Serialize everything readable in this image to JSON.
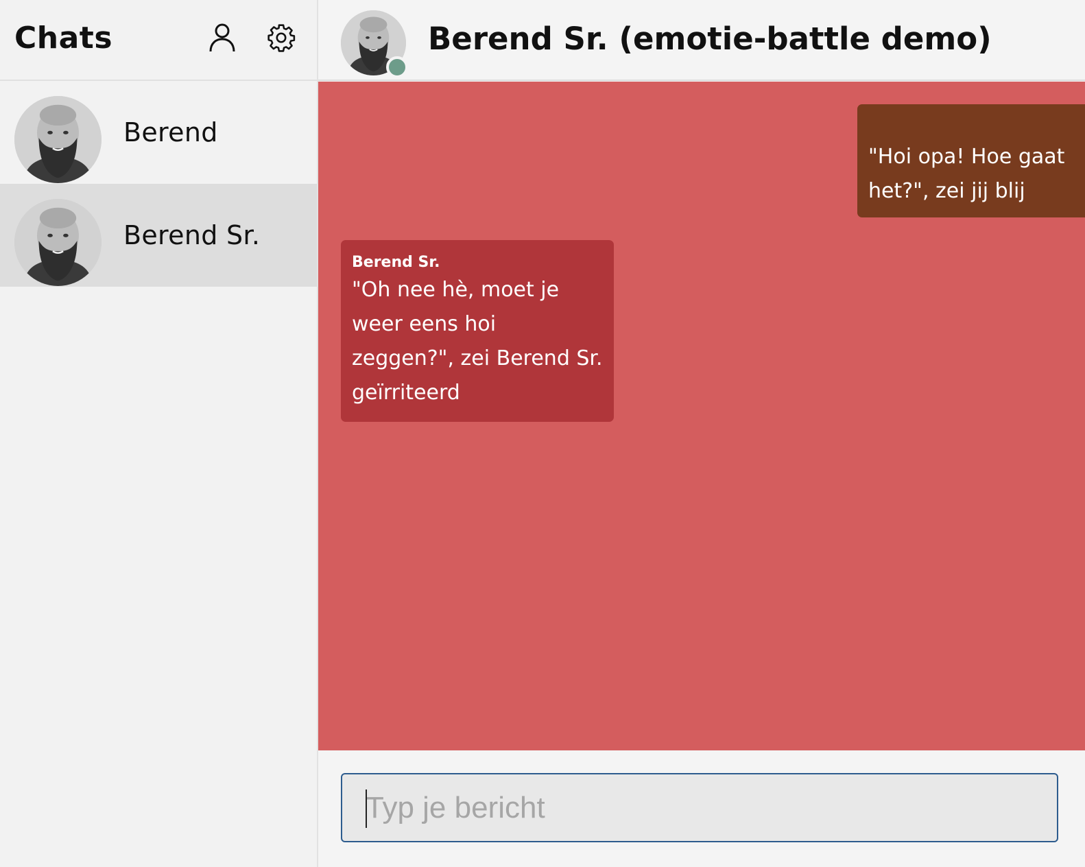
{
  "sidebar": {
    "title": "Chats",
    "icons": {
      "profile": "user-icon",
      "settings": "gear-icon"
    },
    "contacts": [
      {
        "name": "Berend",
        "active": false
      },
      {
        "name": "Berend Sr.",
        "active": true
      }
    ]
  },
  "chat": {
    "title": "Berend Sr. (emotie-battle demo)",
    "status": "online",
    "colors": {
      "background": "#d45d5e",
      "outgoing": "#783b1e",
      "incoming": "#b0363a",
      "online": "#6d9c8a"
    },
    "messages": [
      {
        "direction": "outgoing",
        "text": "\"Hoi opa! Hoe gaat het?\", zei jij blij"
      },
      {
        "direction": "incoming",
        "sender": "Berend Sr.",
        "text": "\"Oh nee hè, moet je weer eens hoi zeggen?\", zei Berend Sr. geïrriteerd"
      }
    ]
  },
  "composer": {
    "placeholder": "Typ je bericht",
    "value": ""
  }
}
